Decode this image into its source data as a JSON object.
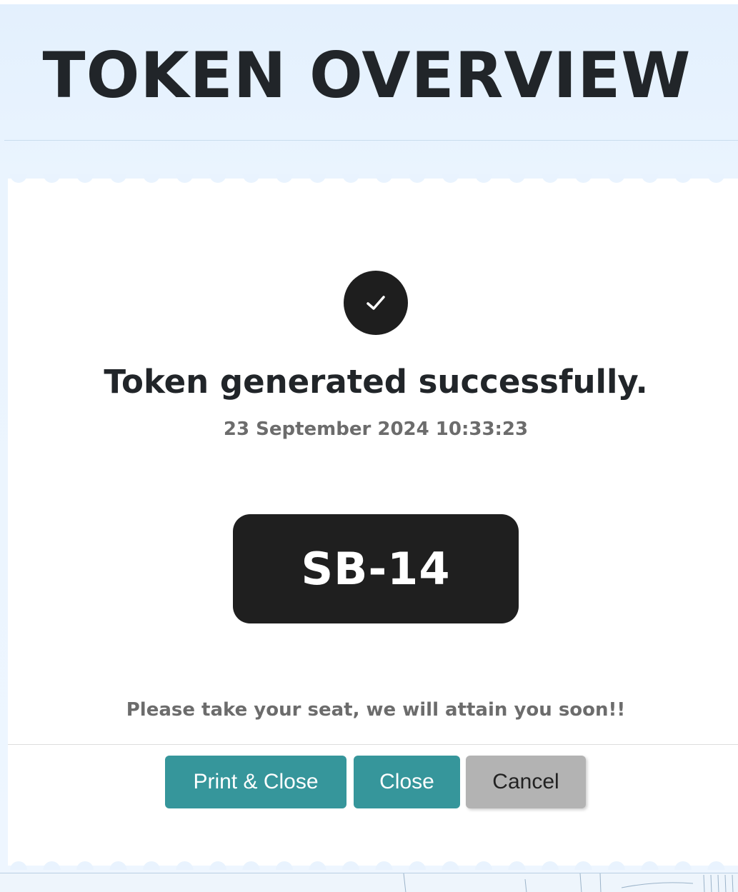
{
  "header": {
    "title": "TOKEN OVERVIEW"
  },
  "dialog": {
    "status_icon": "check-icon",
    "success_message": "Token generated successfully.",
    "timestamp": "23 September 2024 10:33:23",
    "token_number": "SB-14",
    "instruction": "Please take your seat, we will attain you soon!!"
  },
  "actions": {
    "print_close_label": "Print & Close",
    "close_label": "Close",
    "cancel_label": "Cancel"
  },
  "colors": {
    "primary_button": "#36969b",
    "secondary_button": "#b3b3b3",
    "token_background": "#1f1f1f",
    "header_background": "#e3f0fd"
  }
}
